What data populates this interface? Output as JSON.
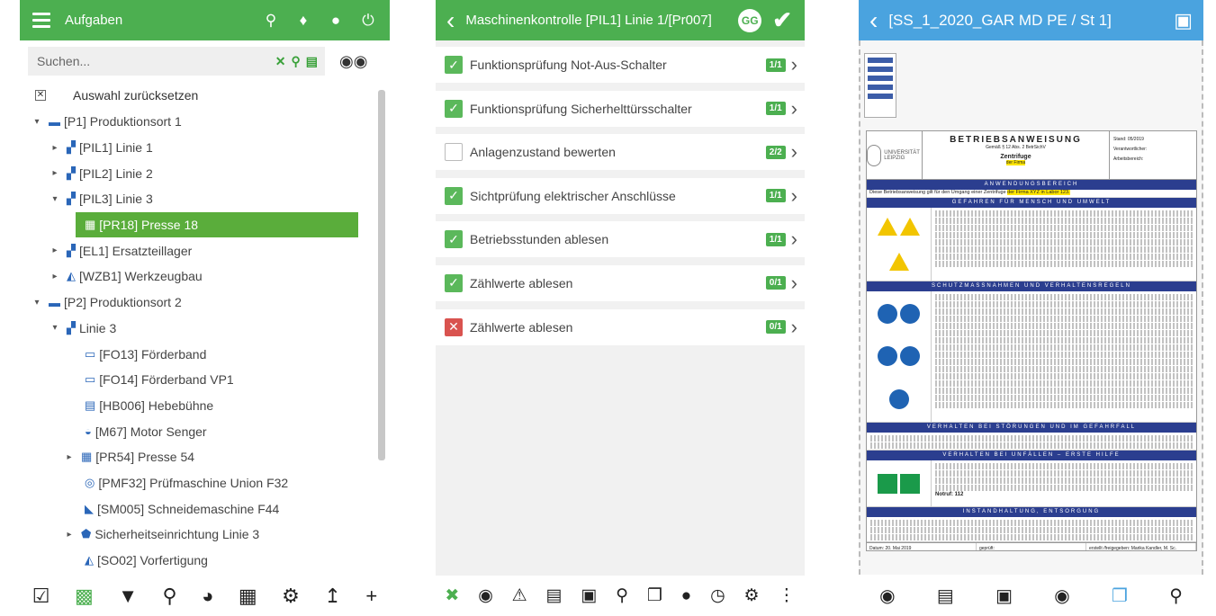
{
  "panel1": {
    "title": "Aufgaben",
    "search_placeholder": "Suchen...",
    "reset_label": "Auswahl zurücksetzen",
    "tree": [
      {
        "label": "[P1] Produktionsort 1",
        "level": 0,
        "caret": "▾",
        "icon": "▬"
      },
      {
        "label": "[PIL1] Linie 1",
        "level": 1,
        "caret": "▸",
        "icon": "▞"
      },
      {
        "label": "[PIL2] Linie 2",
        "level": 1,
        "caret": "▸",
        "icon": "▞"
      },
      {
        "label": "[PIL3] Linie 3",
        "level": 1,
        "caret": "▾",
        "icon": "▞"
      },
      {
        "label": "[PR18] Presse 18",
        "level": 2,
        "caret": "",
        "icon": "▦",
        "selected": true
      },
      {
        "label": "[EL1] Ersatzteillager",
        "level": 1,
        "caret": "▸",
        "icon": "▞"
      },
      {
        "label": "[WZB1] Werkzeugbau",
        "level": 1,
        "caret": "▸",
        "icon": "◭"
      },
      {
        "label": "[P2] Produktionsort 2",
        "level": 0,
        "caret": "▾",
        "icon": "▬"
      },
      {
        "label": "Linie 3",
        "level": 1,
        "caret": "▾",
        "icon": "▞"
      },
      {
        "label": "[FO13] Förderband",
        "level": 2,
        "caret": "",
        "icon": "▭"
      },
      {
        "label": "[FO14] Förderband VP1",
        "level": 2,
        "caret": "",
        "icon": "▭"
      },
      {
        "label": "[HB006] Hebebühne",
        "level": 2,
        "caret": "",
        "icon": "▤"
      },
      {
        "label": "[M67] Motor Senger",
        "level": 2,
        "caret": "",
        "icon": "◒"
      },
      {
        "label": "[PR54] Presse 54",
        "level": 1,
        "caret": "▸",
        "icon": "▦",
        "indent_extra": true
      },
      {
        "label": "[PMF32] Prüfmaschine Union F32",
        "level": 2,
        "caret": "",
        "icon": "◎"
      },
      {
        "label": "[SM005] Schneidemaschine F44",
        "level": 2,
        "caret": "",
        "icon": "◣"
      },
      {
        "label": "Sicherheitseinrichtung Linie 3",
        "level": 1,
        "caret": "▸",
        "icon": "⬟",
        "indent_extra": true
      },
      {
        "label": "[SO02] Vorfertigung",
        "level": 2,
        "caret": "",
        "icon": "◭"
      }
    ]
  },
  "panel2": {
    "title": "Maschinenkontrolle [PIL1] Linie 1/[Pr007]",
    "user_initials": "GG",
    "items": [
      {
        "label": "Funktionsprüfung Not-Aus-Schalter",
        "status": "ok",
        "badge": "1/1"
      },
      {
        "label": "Funktionsprüfung Sicherhelttürsschalter",
        "status": "ok",
        "badge": "1/1"
      },
      {
        "label": "Anlagenzustand bewerten",
        "status": "empty",
        "badge": "2/2"
      },
      {
        "label": "Sichtprüfung elektrischer Anschlüsse",
        "status": "ok",
        "badge": "1/1"
      },
      {
        "label": "Betriebsstunden ablesen",
        "status": "ok",
        "badge": "1/1"
      },
      {
        "label": "Zählwerte ablesen",
        "status": "ok",
        "badge": "0/1"
      },
      {
        "label": "Zählwerte ablesen",
        "status": "fail",
        "badge": "0/1"
      }
    ]
  },
  "panel3": {
    "title": "[SS_1_2020_GAR MD PE / St 1]",
    "doc": {
      "heading": "BETRIEBSANWEISUNG",
      "subheading": "Gemäß § 12 Abs. 2 BetrSichV",
      "subject": "Zentrifuge",
      "firm": "der Firma",
      "university": "UNIVERSITÄT LEIPZIG",
      "right_lines": [
        "Stand: 05/2019",
        "Verantwortlicher:",
        "Arbeitsbereich:"
      ],
      "sections": [
        "ANWENDUNGSBEREICH",
        "GEFAHREN FÜR MENSCH UND UMWELT",
        "SCHUTZMASSNAHMEN UND VERHALTENSREGELN",
        "VERHALTEN BEI STÖRUNGEN UND IM GEFAHRFALL",
        "VERHALTEN BEI UNFÄLLEN – ERSTE HILFE",
        "INSTANDHALTUNG, ENTSORGUNG"
      ],
      "scope_text": "Diese Betriebsanweisung gilt für den Umgang einer Zentrifuge",
      "scope_highlight": "der Firma XYZ in Labor 123.",
      "notruf": "Notruf: 112",
      "footer_date": "Datum: 20. Mai 2019",
      "footer_checked": "geprüft:",
      "footer_signed": "erstellt /freigegeben: Marika Kandler, M. Sc. Sicherheitsbeauftragte"
    }
  }
}
